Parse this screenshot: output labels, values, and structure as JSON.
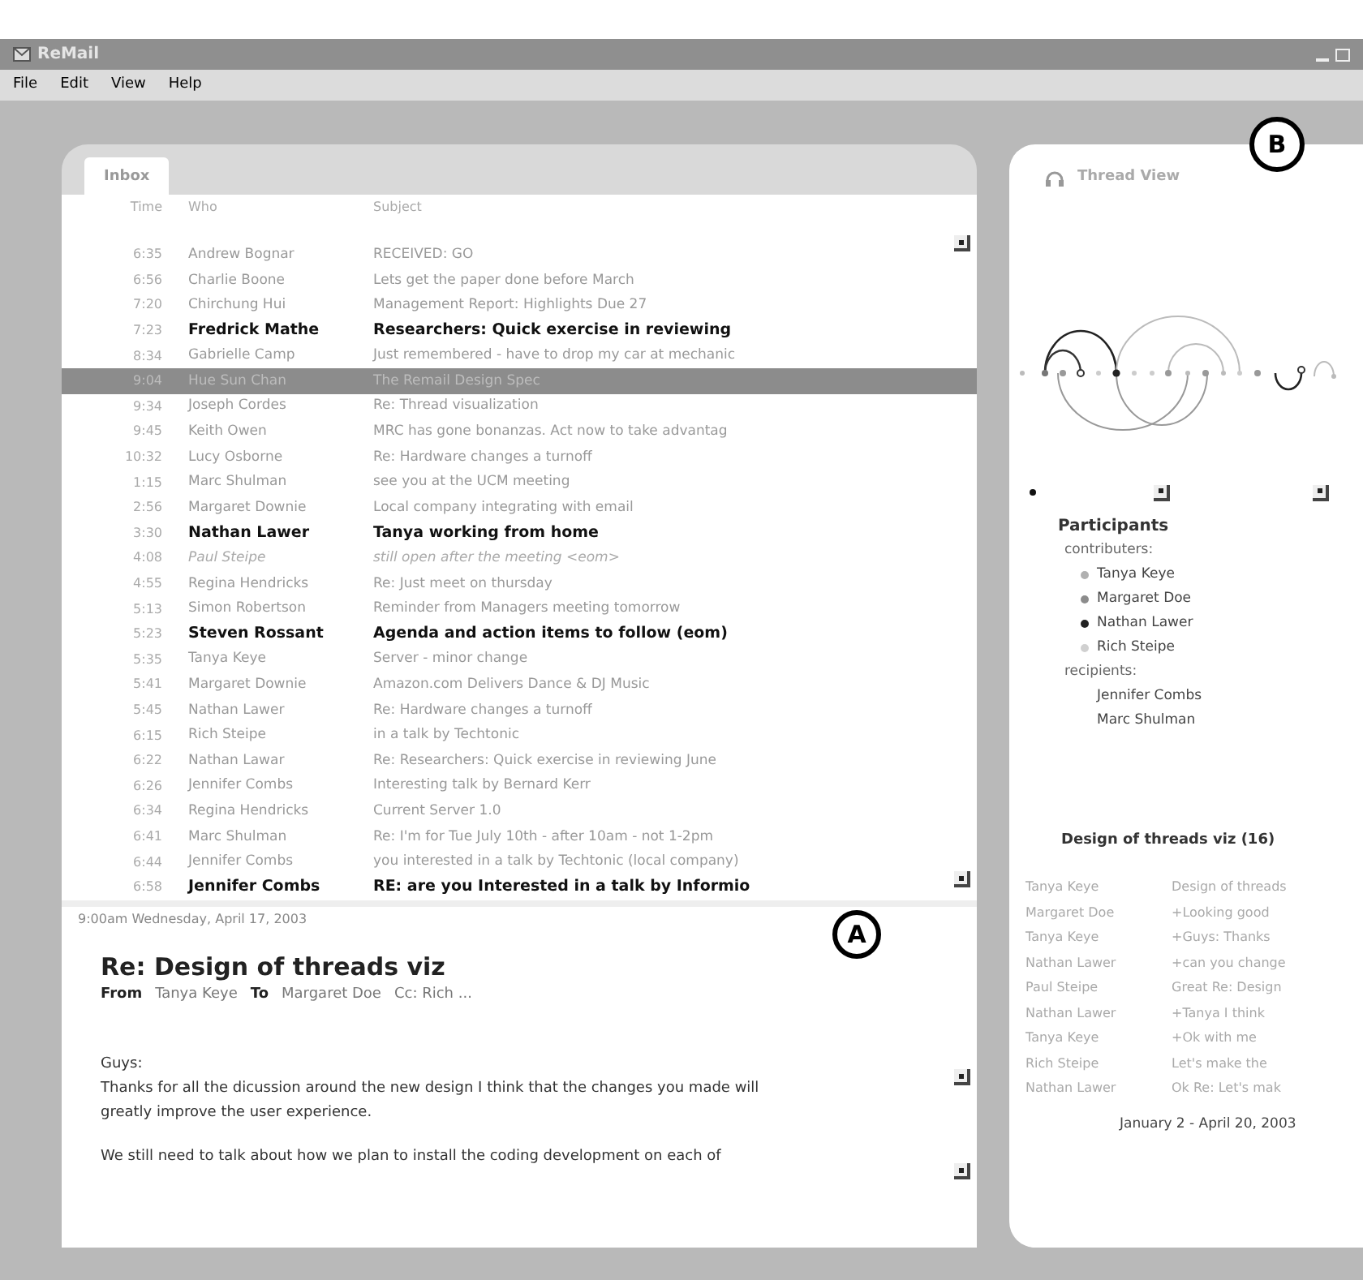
{
  "window": {
    "title": "ReMail"
  },
  "menu": [
    "File",
    "Edit",
    "View",
    "Help"
  ],
  "inbox": {
    "tab": "Inbox",
    "columns": [
      "Time",
      "Who",
      "Subject"
    ],
    "rows": [
      {
        "time": "6:35",
        "who": "Andrew Bognar",
        "subject": "RECEIVED: GO",
        "kind": "read",
        "selected": false
      },
      {
        "time": "6:56",
        "who": "Charlie Boone",
        "subject": "Lets get the paper done before March",
        "kind": "read",
        "selected": false
      },
      {
        "time": "7:20",
        "who": "Chirchung Hui",
        "subject": "Management Report: Highlights Due 27",
        "kind": "read",
        "selected": false
      },
      {
        "time": "7:23",
        "who": "Fredrick Mathe",
        "subject": "Researchers: Quick exercise in reviewing",
        "kind": "unread",
        "selected": false
      },
      {
        "time": "8:34",
        "who": "Gabrielle Camp",
        "subject": "Just remembered - have to drop my car at mechanic",
        "kind": "read",
        "selected": false
      },
      {
        "time": "9:04",
        "who": "Hue Sun Chan",
        "subject": "The Remail Design Spec",
        "kind": "read",
        "selected": true
      },
      {
        "time": "9:34",
        "who": "Joseph Cordes",
        "subject": "Re: Thread visualization",
        "kind": "read",
        "selected": false
      },
      {
        "time": "9:45",
        "who": "Keith Owen",
        "subject": "MRC has gone bonanzas. Act now to take advantag",
        "kind": "read",
        "selected": false
      },
      {
        "time": "10:32",
        "who": "Lucy Osborne",
        "subject": "Re: Hardware changes a turnoff",
        "kind": "read",
        "selected": false
      },
      {
        "time": "1:15",
        "who": "Marc Shulman",
        "subject": "see you at the UCM meeting",
        "kind": "read",
        "selected": false
      },
      {
        "time": "2:56",
        "who": "Margaret Downie",
        "subject": "Local company integrating with email",
        "kind": "read",
        "selected": false
      },
      {
        "time": "3:30",
        "who": "Nathan Lawer",
        "subject": "Tanya working from home",
        "kind": "unread",
        "selected": false
      },
      {
        "time": "4:08",
        "who": "Paul Steipe",
        "subject": "still open after the meeting <eom>",
        "kind": "draft",
        "selected": false
      },
      {
        "time": "4:55",
        "who": "Regina Hendricks",
        "subject": "Re: Just meet on thursday",
        "kind": "read",
        "selected": false
      },
      {
        "time": "5:13",
        "who": "Simon Robertson",
        "subject": "Reminder from Managers meeting tomorrow",
        "kind": "read",
        "selected": false
      },
      {
        "time": "5:23",
        "who": "Steven Rossant",
        "subject": "Agenda and action items to follow (eom)",
        "kind": "unread",
        "selected": false
      },
      {
        "time": "5:35",
        "who": "Tanya Keye",
        "subject": "Server - minor change",
        "kind": "read",
        "selected": false
      },
      {
        "time": "5:41",
        "who": "Margaret Downie",
        "subject": "Amazon.com Delivers Dance & DJ Music",
        "kind": "read",
        "selected": false
      },
      {
        "time": "5:45",
        "who": "Nathan Lawer",
        "subject": "Re: Hardware changes a turnoff",
        "kind": "read",
        "selected": false
      },
      {
        "time": "6:15",
        "who": "Rich Steipe",
        "subject": "in a talk by Techtonic",
        "kind": "read",
        "selected": false
      },
      {
        "time": "6:22",
        "who": "Nathan Lawar",
        "subject": "Re: Researchers: Quick exercise in reviewing June",
        "kind": "read",
        "selected": false
      },
      {
        "time": "6:26",
        "who": "Jennifer Combs",
        "subject": "Interesting talk by Bernard Kerr",
        "kind": "read",
        "selected": false
      },
      {
        "time": "6:34",
        "who": "Regina Hendricks",
        "subject": "Current Server 1.0",
        "kind": "read",
        "selected": false
      },
      {
        "time": "6:41",
        "who": "Marc Shulman",
        "subject": "Re: I'm for Tue July 10th - after 10am - not 1-2pm",
        "kind": "read",
        "selected": false
      },
      {
        "time": "6:44",
        "who": "Jennifer Combs",
        "subject": "you interested in a talk by Techtonic (local company)",
        "kind": "read",
        "selected": false
      },
      {
        "time": "6:58",
        "who": "Jennifer Combs",
        "subject": "RE: are you Interested in a talk by Informio",
        "kind": "unread",
        "selected": false
      }
    ]
  },
  "message": {
    "date": "9:00am Wednesday, April 17, 2003",
    "subject": "Re: Design of threads viz",
    "from_label": "From",
    "from": "Tanya Keye",
    "to_label": "To",
    "to": "Margaret Doe",
    "cc": "Cc: Rich ...",
    "body": [
      "Guys:",
      "Thanks for all the dicussion around the new design I think that the changes you made will greatly improve the user experience.",
      "We still need to talk about how we plan to install the coding development on each of"
    ]
  },
  "thread_view": {
    "title": "Thread View",
    "participants": {
      "title": "Participants",
      "groups": [
        {
          "label": "contributers:",
          "children": [
            {
              "name": "Tanya Keye",
              "color": "#b0b0b0"
            },
            {
              "name": "Margaret Doe",
              "color": "#8c8c8c"
            },
            {
              "name": "Nathan Lawer",
              "color": "#222222"
            },
            {
              "name": "Rich Steipe",
              "color": "#d0d0d0"
            }
          ]
        },
        {
          "label": "recipients:",
          "children": [
            {
              "name": "Jennifer Combs"
            },
            {
              "name": "Marc Shulman"
            }
          ]
        }
      ]
    },
    "thread_title": "Design of threads viz (16)",
    "messages": [
      {
        "who": "Tanya Keye",
        "text": "Design of threads"
      },
      {
        "who": "Margaret Doe",
        "text": "+Looking good"
      },
      {
        "who": "Tanya Keye",
        "text": "+Guys: Thanks"
      },
      {
        "who": "Nathan Lawer",
        "text": "+can you change"
      },
      {
        "who": "Paul Steipe",
        "text": "Great Re: Design"
      },
      {
        "who": "Nathan Lawer",
        "text": "+Tanya I think"
      },
      {
        "who": "Tanya Keye",
        "text": "+Ok with me"
      },
      {
        "who": "Rich Steipe",
        "text": "Let's make the"
      },
      {
        "who": "Nathan Lawer",
        "text": "Ok Re: Let's mak"
      }
    ],
    "date_range": "January 2 - April 20, 2003"
  },
  "callouts": [
    "A",
    "B"
  ]
}
